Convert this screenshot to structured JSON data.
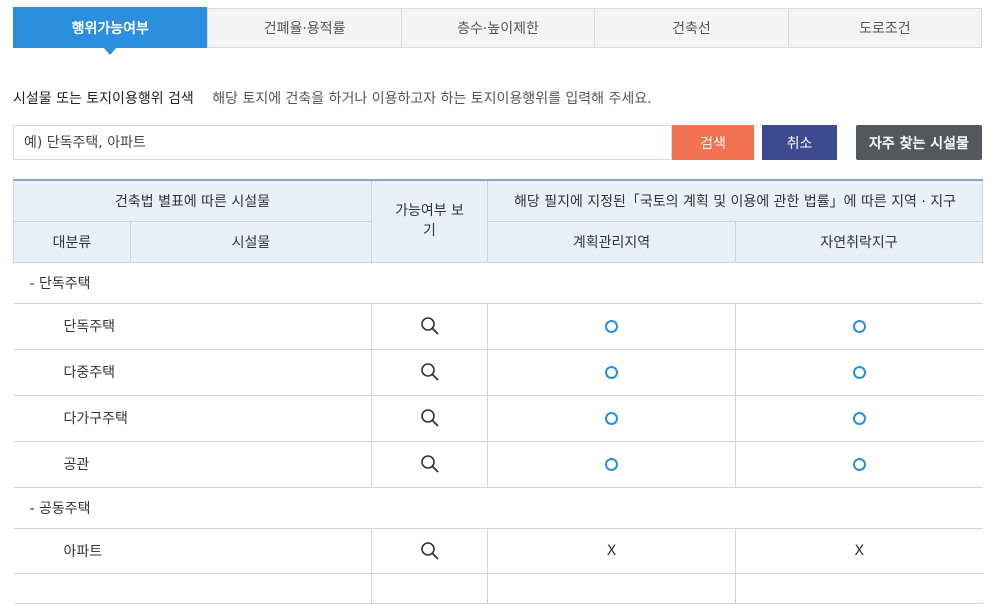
{
  "tabs": [
    {
      "label": "행위가능여부",
      "active": true
    },
    {
      "label": "건폐율·용적률",
      "active": false
    },
    {
      "label": "층수·높이제한",
      "active": false
    },
    {
      "label": "건축선",
      "active": false
    },
    {
      "label": "도로조건",
      "active": false
    }
  ],
  "search": {
    "label": "시설물 또는 토지이용행위 검색",
    "description": "해당 토지에 건축을 하거나 이용하고자 하는 토지이용행위를 입력해 주세요.",
    "placeholder": "예) 단독주택, 아파트",
    "search_button": "검색",
    "cancel_button": "취소",
    "frequent_button": "자주 찾는 시설물"
  },
  "table": {
    "header_facility_group": "건축법 별표에 따른 시설물",
    "header_possible": "가능여부 보기",
    "header_zones_title": "해당 필지에 지정된「국토의 계획 및 이용에 관한 법률」에 따른 지역 · 지구",
    "header_category": "대분류",
    "header_facility": "시설물",
    "zones": [
      "계획관리지역",
      "자연취락지구"
    ],
    "groups": [
      {
        "title": "- 단독주택",
        "rows": [
          {
            "name": "단독주택",
            "values": [
              "O",
              "O"
            ]
          },
          {
            "name": "다중주택",
            "values": [
              "O",
              "O"
            ]
          },
          {
            "name": "다가구주택",
            "values": [
              "O",
              "O"
            ]
          },
          {
            "name": "공관",
            "values": [
              "O",
              "O"
            ]
          }
        ]
      },
      {
        "title": "- 공동주택",
        "rows": [
          {
            "name": "아파트",
            "values": [
              "X",
              "X"
            ]
          }
        ]
      }
    ]
  },
  "icons": {
    "view": "magnifier-icon",
    "possible": "circle-o-icon"
  },
  "colors": {
    "accent": "#2b8fde",
    "search": "#f27354",
    "cancel": "#3c4a8e",
    "frequent": "#54575c"
  }
}
